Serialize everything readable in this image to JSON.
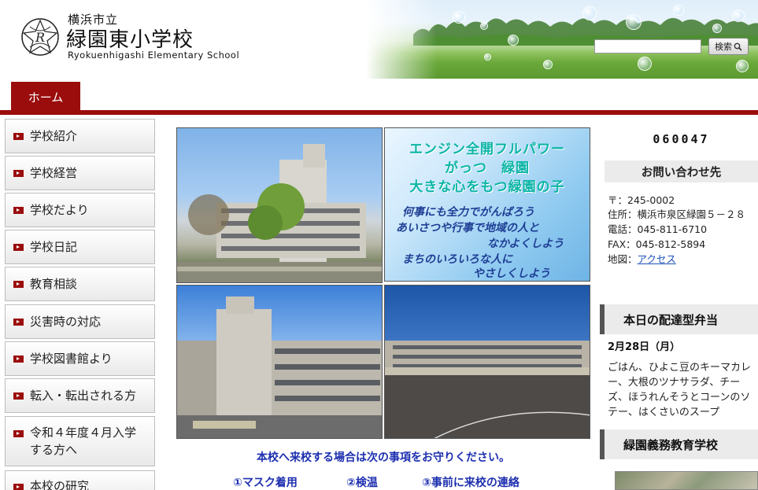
{
  "header": {
    "prefecture": "横浜市立",
    "school_name": "緑園東小学校",
    "school_name_en": "Ryokuenhigashi Elementary School",
    "search_button": "検索"
  },
  "nav": {
    "home_label": "ホーム"
  },
  "sidebar": {
    "items": [
      {
        "label": "学校紹介"
      },
      {
        "label": "学校経営"
      },
      {
        "label": "学校だより"
      },
      {
        "label": "学校日記"
      },
      {
        "label": "教育相談"
      },
      {
        "label": "災害時の対応"
      },
      {
        "label": "学校図書館より"
      },
      {
        "label": "転入・転出される方"
      },
      {
        "label": "令和４年度４月入学",
        "label2": "する方へ"
      },
      {
        "label": "本校の研究"
      }
    ]
  },
  "slogan": {
    "line1": "エンジン全開フルパワー",
    "line2": "がっつ　緑園",
    "line3": "大きな心をもつ緑園の子",
    "motto1": "何事にも全力でがんばろう",
    "motto2": "あいさつや行事で地域の人と",
    "motto3": "なかよくしよう",
    "motto4": "まちのいろいろな人に",
    "motto5": "やさしくしよう"
  },
  "notice": {
    "text": "本校へ来校する場合は次の事項をお守りください。",
    "rule1": "①マスク着用",
    "rule2": "②検温",
    "rule3": "③事前に来校の連絡"
  },
  "right": {
    "counter": "060047",
    "contact_title": "お問い合わせ先",
    "postal": "〒：245-0002",
    "address": "住所：横浜市泉区緑園５－２８",
    "phone": "電話：045-811-6710",
    "fax": "FAX：045-812-5894",
    "map_label": "地図：",
    "map_link": "アクセス",
    "lunch_title": "本日の配達型弁当",
    "lunch_date": "2月28日（月）",
    "lunch_menu": "ごはん、ひよこ豆のキーマカレー、大根のツナサラダ、チーズ、ほうれんそうとコーンのソテー、はくさいのスープ",
    "compulsory_title": "緑園義務教育学校"
  },
  "colors": {
    "accent": "#9b0d0d",
    "link": "#1d4fb8",
    "notice": "#1d2fb0"
  }
}
